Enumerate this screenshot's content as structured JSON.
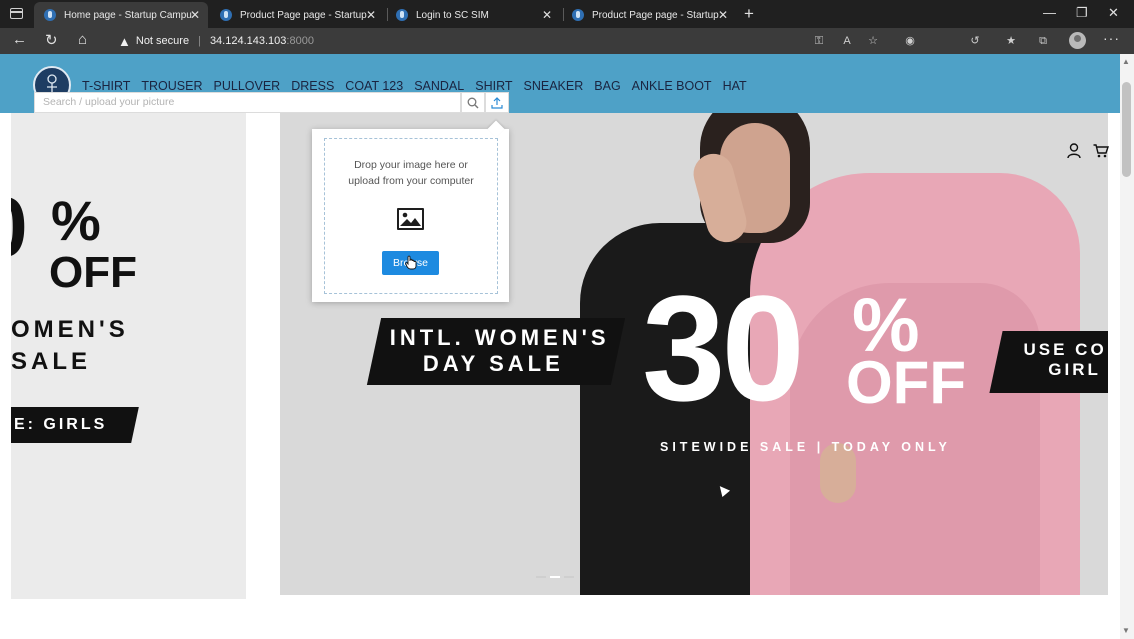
{
  "browser": {
    "tabs": [
      {
        "title": "Home page - Startup Campus e",
        "active": true
      },
      {
        "title": "Product Page page - Startup Ca",
        "active": false
      },
      {
        "title": "Login to SC SIM",
        "active": false
      },
      {
        "title": "Product Page page - Startup Ca",
        "active": false
      }
    ],
    "security_label": "Not secure",
    "url_host": "34.124.143.103",
    "url_port": ":8000"
  },
  "nav": {
    "items": [
      "T-SHIRT",
      "TROUSER",
      "PULLOVER",
      "DRESS",
      "COAT 123",
      "SANDAL",
      "SHIRT",
      "SNEAKER",
      "BAG",
      "ANKLE BOOT",
      "HAT"
    ]
  },
  "search": {
    "placeholder": "Search / upload your picture"
  },
  "upload_popup": {
    "line1": "Drop your image here or",
    "line2": "upload from your computer",
    "browse_label": "Browse"
  },
  "hero_left": {
    "pct": "0",
    "pct_sign": "%",
    "off": "OFF",
    "line1": "OMEN'S",
    "line2": "SALE",
    "tag": "E: GIRLS"
  },
  "hero": {
    "tag_line1": "INTL. WOMEN'S",
    "tag_line2": "DAY SALE",
    "big_number": "30",
    "pct_sign": "%",
    "off": "OFF",
    "sitewide": "SITEWIDE SALE  |  TODAY ONLY",
    "right_tag_line1": "USE CO",
    "right_tag_line2": "GIRL"
  },
  "colors": {
    "header_bg": "#4ea1c7",
    "browse_button": "#1d8ae0",
    "coat_pink": "#e8a7b6"
  }
}
